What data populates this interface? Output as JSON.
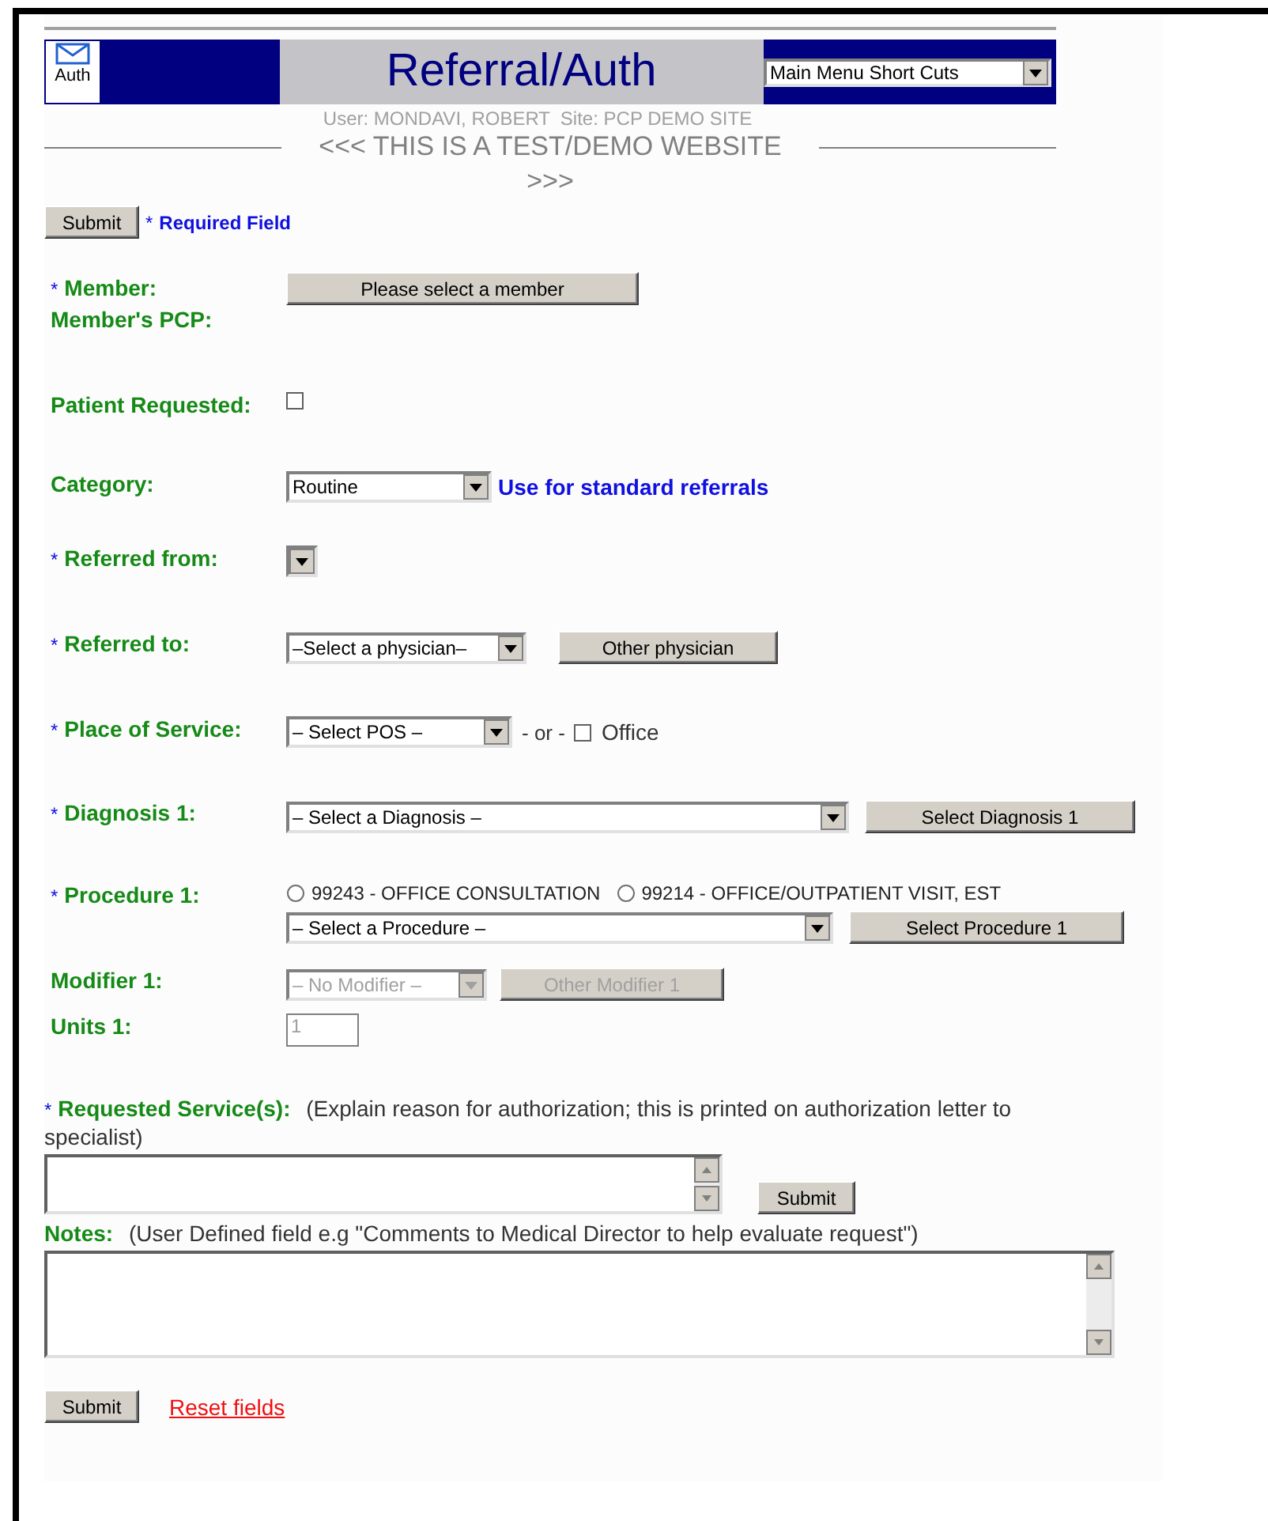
{
  "header": {
    "icon_label": "Auth",
    "title": "Referral/Auth",
    "menu_select": "Main Menu Short Cuts"
  },
  "user_line": "User: MONDAVI, ROBERT  Site: PCP DEMO SITE",
  "banner": "<<< THIS IS A TEST/DEMO WEBSITE >>>",
  "top_actions": {
    "submit": "Submit",
    "required_mark": "*",
    "required_note": "Required Field"
  },
  "fields": [
    {
      "kind": "button",
      "mark": "*",
      "label": "Member:",
      "button": "Please select a member"
    },
    {
      "kind": "text",
      "label": "Member's PCP:"
    },
    {
      "kind": "checkbox",
      "label": "Patient Requested:",
      "checked": false
    },
    {
      "kind": "select",
      "label": "Category:",
      "select": "Routine",
      "hint": "Use for standard referrals"
    },
    {
      "kind": "select",
      "mark": "*",
      "label": "Referred from:"
    },
    {
      "kind": "select",
      "mark": "*",
      "label": "Referred to:",
      "select": "–Select a physician–",
      "button": "Other physician"
    },
    {
      "kind": "pos",
      "mark": "*",
      "label": "Place of Service:",
      "select": "– Select POS –",
      "or_text": "- or -",
      "option": {
        "label": "Office",
        "checked": false
      }
    },
    {
      "kind": "select",
      "mark": "*",
      "label": "Diagnosis 1:",
      "select": "– Select a Diagnosis –",
      "button": "Select Diagnosis 1"
    },
    {
      "kind": "procedure",
      "mark": "*",
      "label": "Procedure 1:",
      "radios": [
        {
          "label": "99243 - OFFICE CONSULTATION",
          "selected": false
        },
        {
          "label": "99214 - OFFICE/OUTPATIENT VISIT, EST",
          "selected": false
        }
      ],
      "select": "– Select a Procedure –",
      "button": "Select Procedure 1"
    },
    {
      "kind": "select",
      "label": "Modifier 1:",
      "select": "– No Modifier –",
      "button": "Other Modifier 1",
      "disabled": true
    },
    {
      "kind": "input",
      "label": "Units 1:",
      "value": "1",
      "disabled": true
    }
  ],
  "requested": {
    "mark": "*",
    "label": "Requested Service(s):",
    "note": "(Explain reason for authorization; this is printed on authorization letter to specialist)",
    "submit": "Submit"
  },
  "notes": {
    "label": "Notes:",
    "note": "(User Defined field e.g \"Comments to Medical Director to help evaluate request\")"
  },
  "bottom": {
    "submit": "Submit",
    "reset": "Reset fields"
  }
}
